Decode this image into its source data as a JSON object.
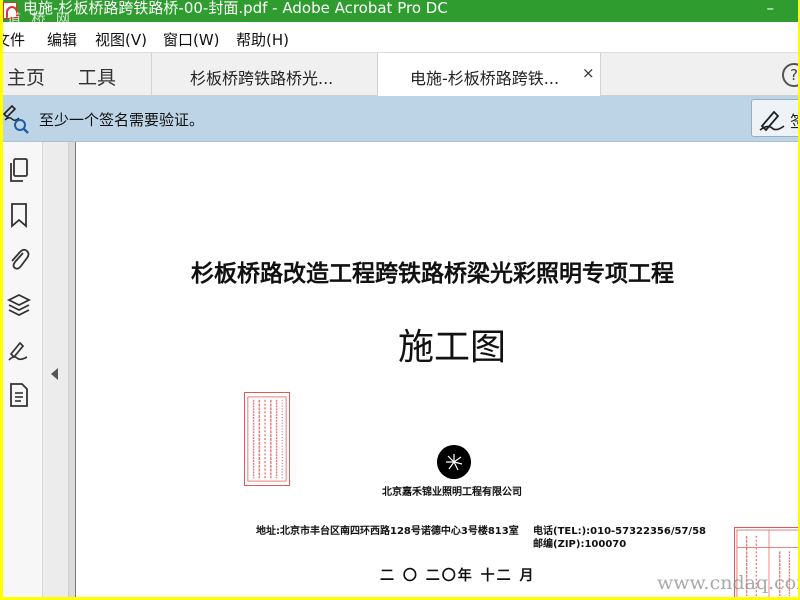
{
  "window": {
    "title": "电施-杉板桥路跨铁路桥-00-封面.pdf - Adobe Acrobat Pro DC",
    "title_watermark": "道 桥 网",
    "minimize_glyph": "–"
  },
  "menu": [
    "文件",
    "编辑",
    "视图(V)",
    "窗口(W)",
    "帮助(H)"
  ],
  "tabs": {
    "home": "主页",
    "tools": "工具",
    "documents": [
      {
        "label": "杉板桥跨铁路桥光...",
        "active": false
      },
      {
        "label": "电施-杉板桥路跨铁...",
        "active": true
      }
    ],
    "close_glyph": "×",
    "help_glyph": "?"
  },
  "signature_bar": {
    "message": "至少一个签名需要验证。",
    "panel_label": "签"
  },
  "document": {
    "title": "杉板桥路改造工程跨铁路桥梁光彩照明专项工程",
    "subtitle": "施工图",
    "company": "北京嘉禾锦业照明工程有限公司",
    "address": "地址:北京市丰台区南四环西路128号诺德中心3号楼813室",
    "phone": "电话(TEL:):010-57322356/57/58",
    "zip": "邮编(ZIP):100070",
    "date": "二 〇 二〇年 十二 月",
    "watermark": "www.cndaq.com"
  },
  "colors": {
    "title_bar": "#2f9c2f",
    "signature_bar": "#bcd4e6",
    "stamp_red": "#e05858",
    "outer_border": "#ffff00"
  }
}
